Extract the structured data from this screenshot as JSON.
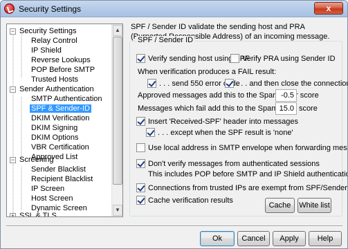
{
  "window": {
    "title": "Security Settings",
    "close_label": "x"
  },
  "tree": {
    "categories": [
      {
        "label": "Security Settings",
        "expander": "−",
        "children": [
          "Relay Control",
          "IP Shield",
          "Reverse Lookups",
          "POP Before SMTP",
          "Trusted Hosts"
        ]
      },
      {
        "label": "Sender Authentication",
        "expander": "−",
        "children": [
          "SMTP Authentication",
          "SPF & Sender-ID",
          "DKIM Verification",
          "DKIM Signing",
          "DKIM Options",
          "VBR Certification",
          "Approved List"
        ]
      },
      {
        "label": "Screening",
        "expander": "−",
        "children": [
          "Sender Blacklist",
          "Recipient Blacklist",
          "IP Screen",
          "Host Screen",
          "Dynamic Screen"
        ]
      },
      {
        "label": "SSL & TLS",
        "expander": "+",
        "children": []
      }
    ],
    "selected": "SPF & Sender-ID"
  },
  "panel": {
    "description": "SPF / Sender ID validate the sending host and PRA (Purported Responsible Address) of an incoming message.",
    "group_title": "SPF / Sender ID",
    "verify_spf": {
      "label": "Verify sending host using SPF",
      "checked": true
    },
    "verify_pra": {
      "label": "Verify PRA using Sender ID",
      "checked": false
    },
    "fail_result_label": "When verification produces a FAIL result:",
    "send_550": {
      "label": ". . . send 550 error code",
      "checked": true
    },
    "close_connection": {
      "label": ". . . and then close the connection",
      "checked": true
    },
    "approved_score_label": "Approved messages add this to the Spam Filter score",
    "approved_score_value": "-0.5",
    "fail_score_label": "Messages which fail add this to the Spam Filter score",
    "fail_score_value": "15.0",
    "insert_header": {
      "label": "Insert 'Received-SPF' header into messages",
      "checked": true
    },
    "except_none": {
      "label": ". . . except when the SPF result is 'none'",
      "checked": true
    },
    "use_local_address": {
      "label": "Use local address in SMTP envelope when forwarding messages",
      "checked": false
    },
    "dont_verify_auth": {
      "label": "Don't verify messages from authenticated sessions",
      "checked": true
    },
    "auth_note": "This includes POP before SMTP and IP Shield authentication.",
    "trusted_exempt": {
      "label": "Connections from trusted IPs are exempt from SPF/Sender ID verification",
      "checked": true
    },
    "cache_results": {
      "label": "Cache verification results",
      "checked": true
    },
    "cache_button": "Cache",
    "whitelist_button": "White list"
  },
  "footer": {
    "ok": "Ok",
    "cancel": "Cancel",
    "apply": "Apply",
    "help": "Help"
  }
}
